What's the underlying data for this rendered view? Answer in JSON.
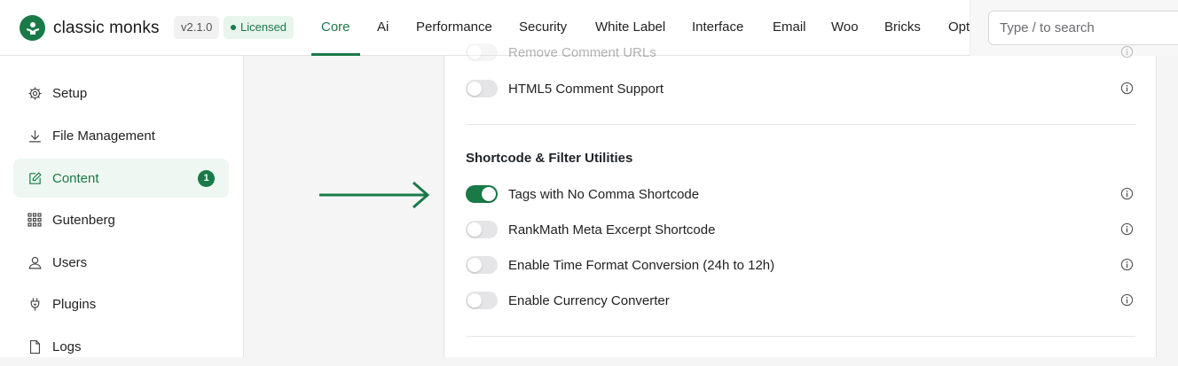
{
  "brand": {
    "name": "classic monks",
    "version": "v2.1.0",
    "license": "Licensed",
    "accent": "#1a7a47"
  },
  "nav": {
    "items": [
      {
        "label": "Core",
        "active": true
      },
      {
        "label": "Ai"
      },
      {
        "label": "Performance"
      },
      {
        "label": "Security"
      },
      {
        "label": "White Label"
      },
      {
        "label": "Interface"
      },
      {
        "label": "Email"
      },
      {
        "label": "Woo"
      },
      {
        "label": "Bricks"
      },
      {
        "label": "Opt"
      }
    ]
  },
  "search": {
    "placeholder": "Type / to search"
  },
  "sidebar": {
    "items": [
      {
        "label": "Setup",
        "icon": "gear-icon"
      },
      {
        "label": "File Management",
        "icon": "download-icon"
      },
      {
        "label": "Content",
        "icon": "edit-icon",
        "active": true,
        "badge": "1"
      },
      {
        "label": "Gutenberg",
        "icon": "grid-icon"
      },
      {
        "label": "Users",
        "icon": "user-icon"
      },
      {
        "label": "Plugins",
        "icon": "plug-icon"
      },
      {
        "label": "Logs",
        "icon": "file-icon"
      }
    ]
  },
  "content": {
    "top_rows": [
      {
        "label": "Remove Comment URLs",
        "enabled": false
      },
      {
        "label": "HTML5 Comment Support",
        "enabled": false
      }
    ],
    "section": {
      "title": "Shortcode & Filter Utilities",
      "rows": [
        {
          "label": "Tags with No Comma Shortcode",
          "enabled": true
        },
        {
          "label": "RankMath Meta Excerpt Shortcode",
          "enabled": false
        },
        {
          "label": "Enable Time Format Conversion (24h to 12h)",
          "enabled": false
        },
        {
          "label": "Enable Currency Converter",
          "enabled": false
        }
      ]
    }
  }
}
